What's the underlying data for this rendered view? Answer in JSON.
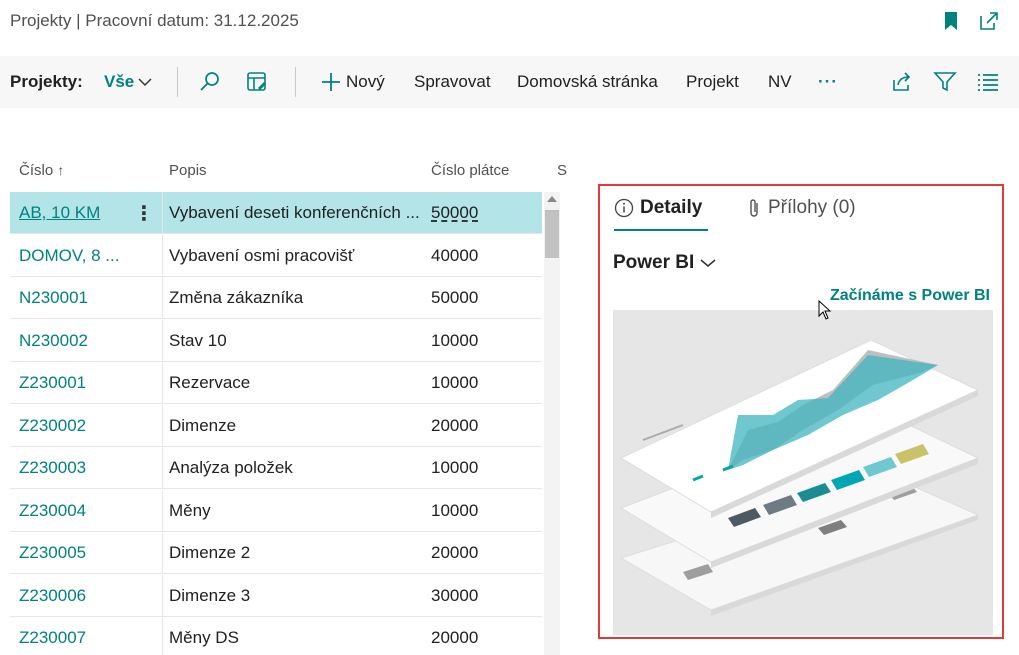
{
  "title": "Projekty | Pracovní datum: 31.12.2025",
  "actionbar": {
    "view_label": "Projekty:",
    "view_value": "Vše",
    "new_label": "Nový",
    "manage_label": "Spravovat",
    "home_label": "Domovská stránka",
    "project_label": "Projekt",
    "nv_label": "NV",
    "more_label": "···"
  },
  "columns": {
    "number": "Číslo",
    "description": "Popis",
    "customer": "Číslo plátce",
    "partial": "S"
  },
  "rows": [
    {
      "no": "AB, 10 KM",
      "desc": "Vybavení deseti konferenčních ...",
      "cust": "50000"
    },
    {
      "no": "DOMOV, 8 ...",
      "desc": "Vybavení osmi pracovišť",
      "cust": "40000"
    },
    {
      "no": "N230001",
      "desc": "Změna zákazníka",
      "cust": "50000"
    },
    {
      "no": "N230002",
      "desc": "Stav 10",
      "cust": "10000"
    },
    {
      "no": "Z230001",
      "desc": "Rezervace",
      "cust": "10000"
    },
    {
      "no": "Z230002",
      "desc": "Dimenze",
      "cust": "20000"
    },
    {
      "no": "Z230003",
      "desc": "Analýza položek",
      "cust": "10000"
    },
    {
      "no": "Z230004",
      "desc": "Měny",
      "cust": "10000"
    },
    {
      "no": "Z230005",
      "desc": "Dimenze 2",
      "cust": "20000"
    },
    {
      "no": "Z230006",
      "desc": "Dimenze 3",
      "cust": "30000"
    },
    {
      "no": "Z230007",
      "desc": "Měny DS",
      "cust": "20000"
    }
  ],
  "factbox": {
    "tab_details": "Detaily",
    "tab_attachments": "Přílohy (0)",
    "powerbi_title": "Power BI",
    "powerbi_link": "Začínáme s Power BI"
  },
  "colors": {
    "accent": "#00827f",
    "selected_row": "#b3e5e8",
    "highlight_border": "#e53935"
  }
}
